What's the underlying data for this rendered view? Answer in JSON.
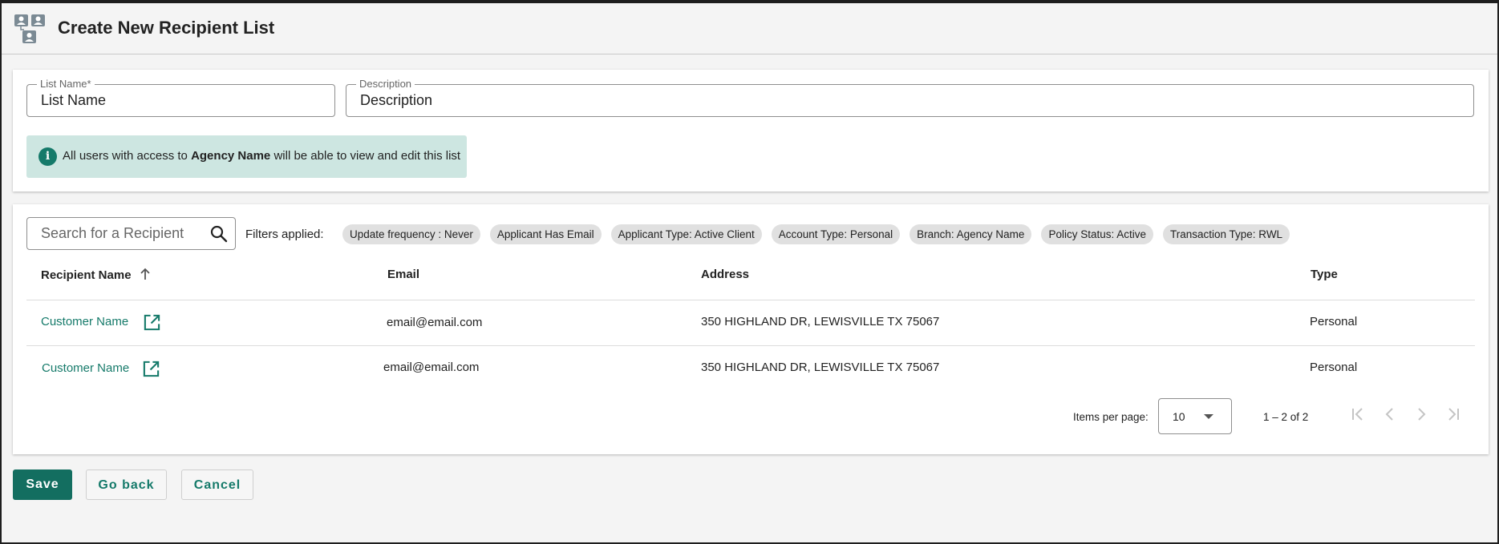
{
  "header": {
    "title": "Create New Recipient List",
    "icon": "contact-list-icon"
  },
  "form": {
    "list_name": {
      "label": "List Name*",
      "value": "List Name"
    },
    "description": {
      "label": "Description",
      "value": "Description"
    },
    "info": {
      "prefix": "All users with access to ",
      "bold": "Agency Name",
      "suffix": " will be able to view and edit this list"
    }
  },
  "search": {
    "placeholder": "Search for a Recipient"
  },
  "filters": {
    "label": "Filters applied:",
    "chips": [
      "Update frequency : Never",
      "Applicant Has Email",
      "Applicant Type: Active Client",
      "Account Type: Personal",
      "Branch: Agency Name",
      "Policy Status: Active",
      "Transaction Type: RWL"
    ]
  },
  "table": {
    "headers": [
      "Recipient Name",
      "Email",
      "Address",
      "Type"
    ],
    "rows": [
      {
        "name": "Customer Name",
        "email": "email@email.com",
        "address": "350 HIGHLAND DR, LEWISVILLE TX 75067",
        "type": "Personal"
      },
      {
        "name": "Customer Name",
        "email": "email@email.com",
        "address": "350 HIGHLAND DR, LEWISVILLE TX 75067",
        "type": "Personal"
      }
    ]
  },
  "paginator": {
    "items_per_page_label": "Items per page:",
    "page_size": "10",
    "range": "1 – 2 of 2"
  },
  "actions": {
    "save": "Save",
    "go_back": "Go back",
    "cancel": "Cancel"
  },
  "colors": {
    "accent": "#157a6a",
    "banner": "#cde6e1",
    "chip": "#e0e0e0"
  }
}
